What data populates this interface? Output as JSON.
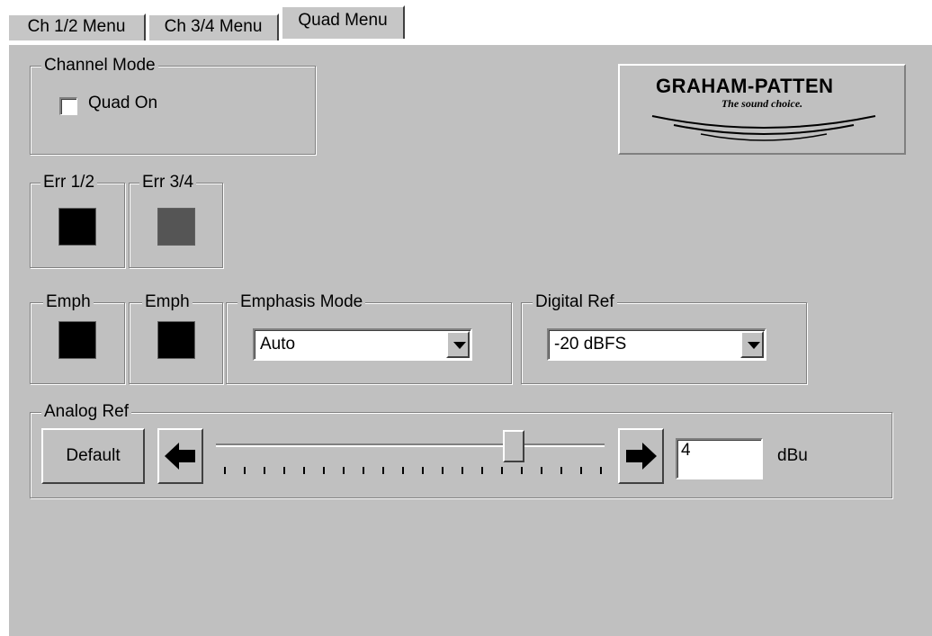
{
  "tabs": [
    {
      "label": "Ch 1/2 Menu",
      "active": false
    },
    {
      "label": "Ch 3/4 Menu",
      "active": false
    },
    {
      "label": "Quad Menu",
      "active": true
    }
  ],
  "channel_mode": {
    "title": "Channel Mode",
    "quad_on_label": "Quad On",
    "quad_on_checked": false
  },
  "logo": {
    "brand": "GRAHAM-PATTEN",
    "tagline": "The sound choice."
  },
  "errors": [
    {
      "label": "Err 1/2",
      "color": "#000000"
    },
    {
      "label": "Err 3/4",
      "color": "#555555"
    }
  ],
  "emphasis_indicators": [
    {
      "label": "Emph",
      "color": "#000000"
    },
    {
      "label": "Emph",
      "color": "#000000"
    }
  ],
  "emphasis_mode": {
    "title": "Emphasis Mode",
    "value": "Auto"
  },
  "digital_ref": {
    "title": "Digital Ref",
    "value": "-20 dBFS"
  },
  "analog_ref": {
    "title": "Analog Ref",
    "default_label": "Default",
    "value": "4",
    "unit": "dBu",
    "slider_position": 0.77,
    "tick_count": 20
  }
}
